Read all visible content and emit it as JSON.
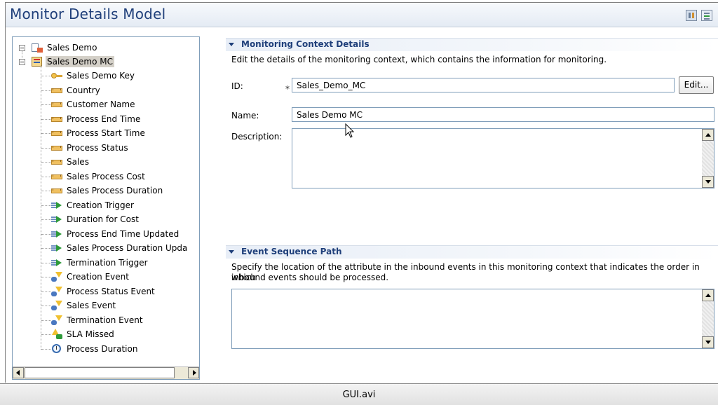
{
  "window": {
    "title": "Monitor Details Model"
  },
  "header_buttons": [
    {
      "icon": "details-view-icon"
    },
    {
      "icon": "outline-view-icon"
    }
  ],
  "tree": {
    "root": {
      "label": "Sales Demo",
      "icon": "model-icon"
    },
    "context": {
      "label": "Sales Demo MC",
      "icon": "monitoring-context-icon",
      "selected": true
    },
    "children": [
      {
        "label": "Sales Demo Key",
        "icon": "key-icon"
      },
      {
        "label": "Country",
        "icon": "metric-icon"
      },
      {
        "label": "Customer Name",
        "icon": "metric-icon"
      },
      {
        "label": "Process End Time",
        "icon": "metric-icon"
      },
      {
        "label": "Process Start Time",
        "icon": "metric-icon"
      },
      {
        "label": "Process Status",
        "icon": "metric-icon"
      },
      {
        "label": "Sales",
        "icon": "metric-icon"
      },
      {
        "label": "Sales Process Cost",
        "icon": "metric-icon"
      },
      {
        "label": "Sales Process Duration",
        "icon": "metric-icon"
      },
      {
        "label": "Creation Trigger",
        "icon": "trigger-icon"
      },
      {
        "label": "Duration for Cost",
        "icon": "trigger-icon"
      },
      {
        "label": "Process End Time Updated",
        "icon": "trigger-icon"
      },
      {
        "label": "Sales Process Duration Upda",
        "icon": "trigger-icon"
      },
      {
        "label": "Termination Trigger",
        "icon": "trigger-icon"
      },
      {
        "label": "Creation Event",
        "icon": "event-icon"
      },
      {
        "label": "Process Status Event",
        "icon": "event-icon"
      },
      {
        "label": "Sales Event",
        "icon": "event-icon"
      },
      {
        "label": "Termination Event",
        "icon": "event-icon"
      },
      {
        "label": "SLA Missed",
        "icon": "outbound-event-icon"
      },
      {
        "label": "Process Duration",
        "icon": "stopwatch-icon"
      }
    ]
  },
  "details": {
    "header": "Monitoring Context Details",
    "description": "Edit the details of the monitoring context, which contains the information for monitoring.",
    "id_label": "ID:",
    "required_marker": "*",
    "id_value": "Sales_Demo_MC",
    "edit_button": "Edit...",
    "name_label": "Name:",
    "name_value": "Sales Demo MC",
    "description_label": "Description:",
    "description_value": ""
  },
  "event_sequence": {
    "header": "Event Sequence Path",
    "description_line1": "Specify the location of the attribute in the inbound events in this monitoring context that indicates the order in which",
    "description_line2": "inbound events should be processed.",
    "value": ""
  },
  "footer": {
    "label": "GUI.avi"
  }
}
